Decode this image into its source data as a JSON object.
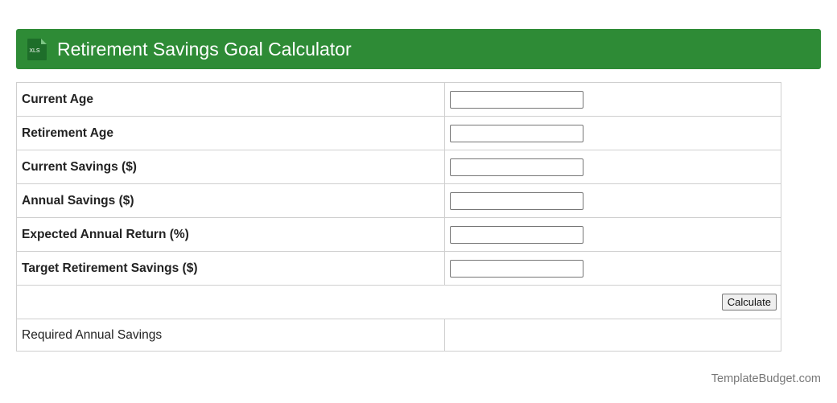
{
  "header": {
    "icon": "xls-file-icon",
    "icon_text": "XLS",
    "title": "Retirement Savings Goal Calculator",
    "background_color": "#2e8b36"
  },
  "form": {
    "fields": [
      {
        "label": "Current Age",
        "value": ""
      },
      {
        "label": "Retirement Age",
        "value": ""
      },
      {
        "label": "Current Savings ($)",
        "value": ""
      },
      {
        "label": "Annual Savings ($)",
        "value": ""
      },
      {
        "label": "Expected Annual Return (%)",
        "value": ""
      },
      {
        "label": "Target Retirement Savings ($)",
        "value": ""
      }
    ],
    "calculate_label": "Calculate",
    "result_label": "Required Annual Savings",
    "result_value": ""
  },
  "footer": {
    "credit": "TemplateBudget.com"
  }
}
